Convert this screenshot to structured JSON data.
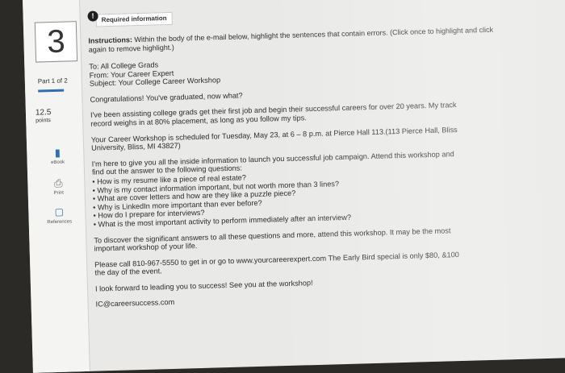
{
  "question": {
    "number": "3",
    "part": "Part 1 of 2",
    "points": "12.5",
    "points_unit": "points"
  },
  "tools": [
    {
      "label": "eBook",
      "icon": "ebook-icon"
    },
    {
      "label": "Print",
      "icon": "printer-icon"
    },
    {
      "label": "References",
      "icon": "references-icon"
    }
  ],
  "header": {
    "badge": "!",
    "label": "Required information"
  },
  "instructions": {
    "prefix": "Instructions:",
    "line1": " Within the body of the e-mail below, highlight the sentences that contain errors. (Click once to highlight and click",
    "line2": "again to remove highlight.)"
  },
  "email": {
    "to": "To: All College Grads",
    "from": "From: Your Career Expert",
    "subject": "Subject: Your College Career Workshop",
    "p1": "Congratulations! You've graduated, now what?",
    "p2": [
      "I've been assisting college grads get their first job and begin their successful careers for over 20 years. My track",
      "record weighs in at 80% placement, as long as you follow my tips."
    ],
    "p3": [
      "Your Career Workshop is scheduled for Tuesday, May 23, at 6 – 8 p.m. at Pierce Hall 113.(113 Pierce Hall, Bliss",
      "University, Bliss, MI 43827)"
    ],
    "p4": [
      "I'm here to give you all the inside information to launch you successful job campaign. Attend this workshop and",
      "find out the answer to the following questions:"
    ],
    "bullets": [
      "How is my resume like a piece of real estate?",
      "Why is my contact information important, but not worth more than 3 lines?",
      "What are cover letters and how are they like a puzzle piece?",
      "Why is LinkedIn more important than ever before?",
      "How do I prepare for interviews?",
      "What is the most important activity to perform immediately after an interview?"
    ],
    "p5": [
      "To discover the significant answers to all these questions and more, attend this workshop. It may be the most",
      "important workshop of your life."
    ],
    "p6": [
      "Please call 810-967-5550 to get in or go to www.yourcareerexpert.com The Early Bird special is only $80, &100",
      "the day of the event."
    ],
    "p7": "I look forward to leading you to success! See you at the workshop!",
    "signature": "IC@careersuccess.com"
  }
}
